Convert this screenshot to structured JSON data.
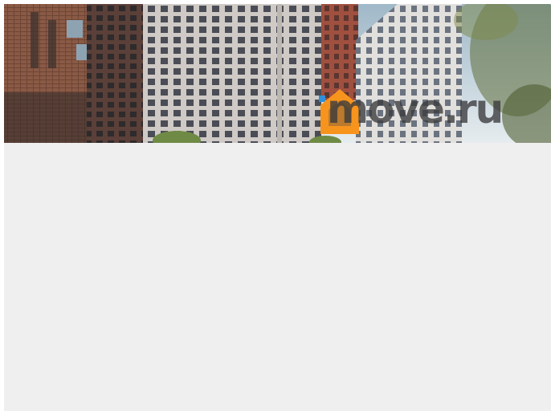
{
  "listing": {
    "photo": {
      "description_icon": "building-photo",
      "sky_color": "#c9d6de",
      "brick_color": "#7a4a3a",
      "facade_color": "#d7d3cf"
    },
    "logo": {
      "brand_text": "move.ru",
      "icon": "house-icon",
      "accent": "#f7941d",
      "accent_secondary": "#2f8fd8"
    }
  },
  "content": {
    "background": "#efefef"
  }
}
